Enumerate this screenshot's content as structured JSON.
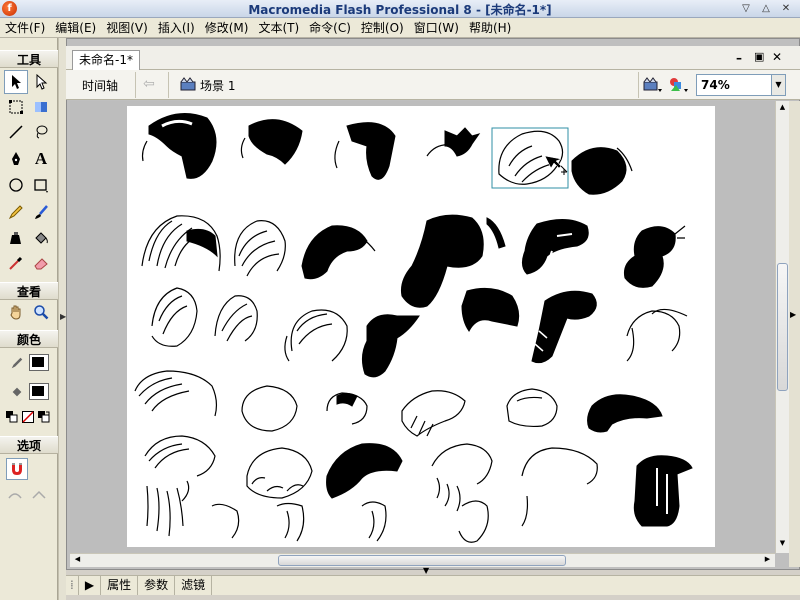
{
  "window": {
    "title": "Macromedia Flash Professional 8 - [未命名-1*]",
    "logo_glyph": "f"
  },
  "menu": [
    "文件(F)",
    "编辑(E)",
    "视图(V)",
    "插入(I)",
    "修改(M)",
    "文本(T)",
    "命令(C)",
    "控制(O)",
    "窗口(W)",
    "帮助(H)"
  ],
  "tools_panel": {
    "tools_label": "工具",
    "view_label": "查看",
    "colors_label": "颜色",
    "options_label": "选项",
    "text_tool_glyph": "A",
    "stroke_color": "#000000",
    "fill_color": "#000000"
  },
  "document": {
    "tab_label": "未命名-1*",
    "timeline_label": "时间轴",
    "scene_label": "场景 1",
    "zoom_value": "74%"
  },
  "bottom_tabs": [
    "属性",
    "参数",
    "滤镜"
  ],
  "colors": {
    "selection_outline": "#2f8fa6",
    "stage_bg": "#ffffff",
    "pasteboard": "#bdbdbd"
  },
  "icons": [
    "arrow-icon",
    "subselect-icon",
    "free-transform-icon",
    "gradient-transform-icon",
    "line-icon",
    "lasso-icon",
    "pen-icon",
    "text-icon",
    "oval-icon",
    "rectangle-icon",
    "pencil-icon",
    "brush-icon",
    "ink-bottle-icon",
    "paint-bucket-icon",
    "eyedropper-icon",
    "eraser-icon",
    "hand-icon",
    "zoom-icon",
    "magnet-icon"
  ]
}
